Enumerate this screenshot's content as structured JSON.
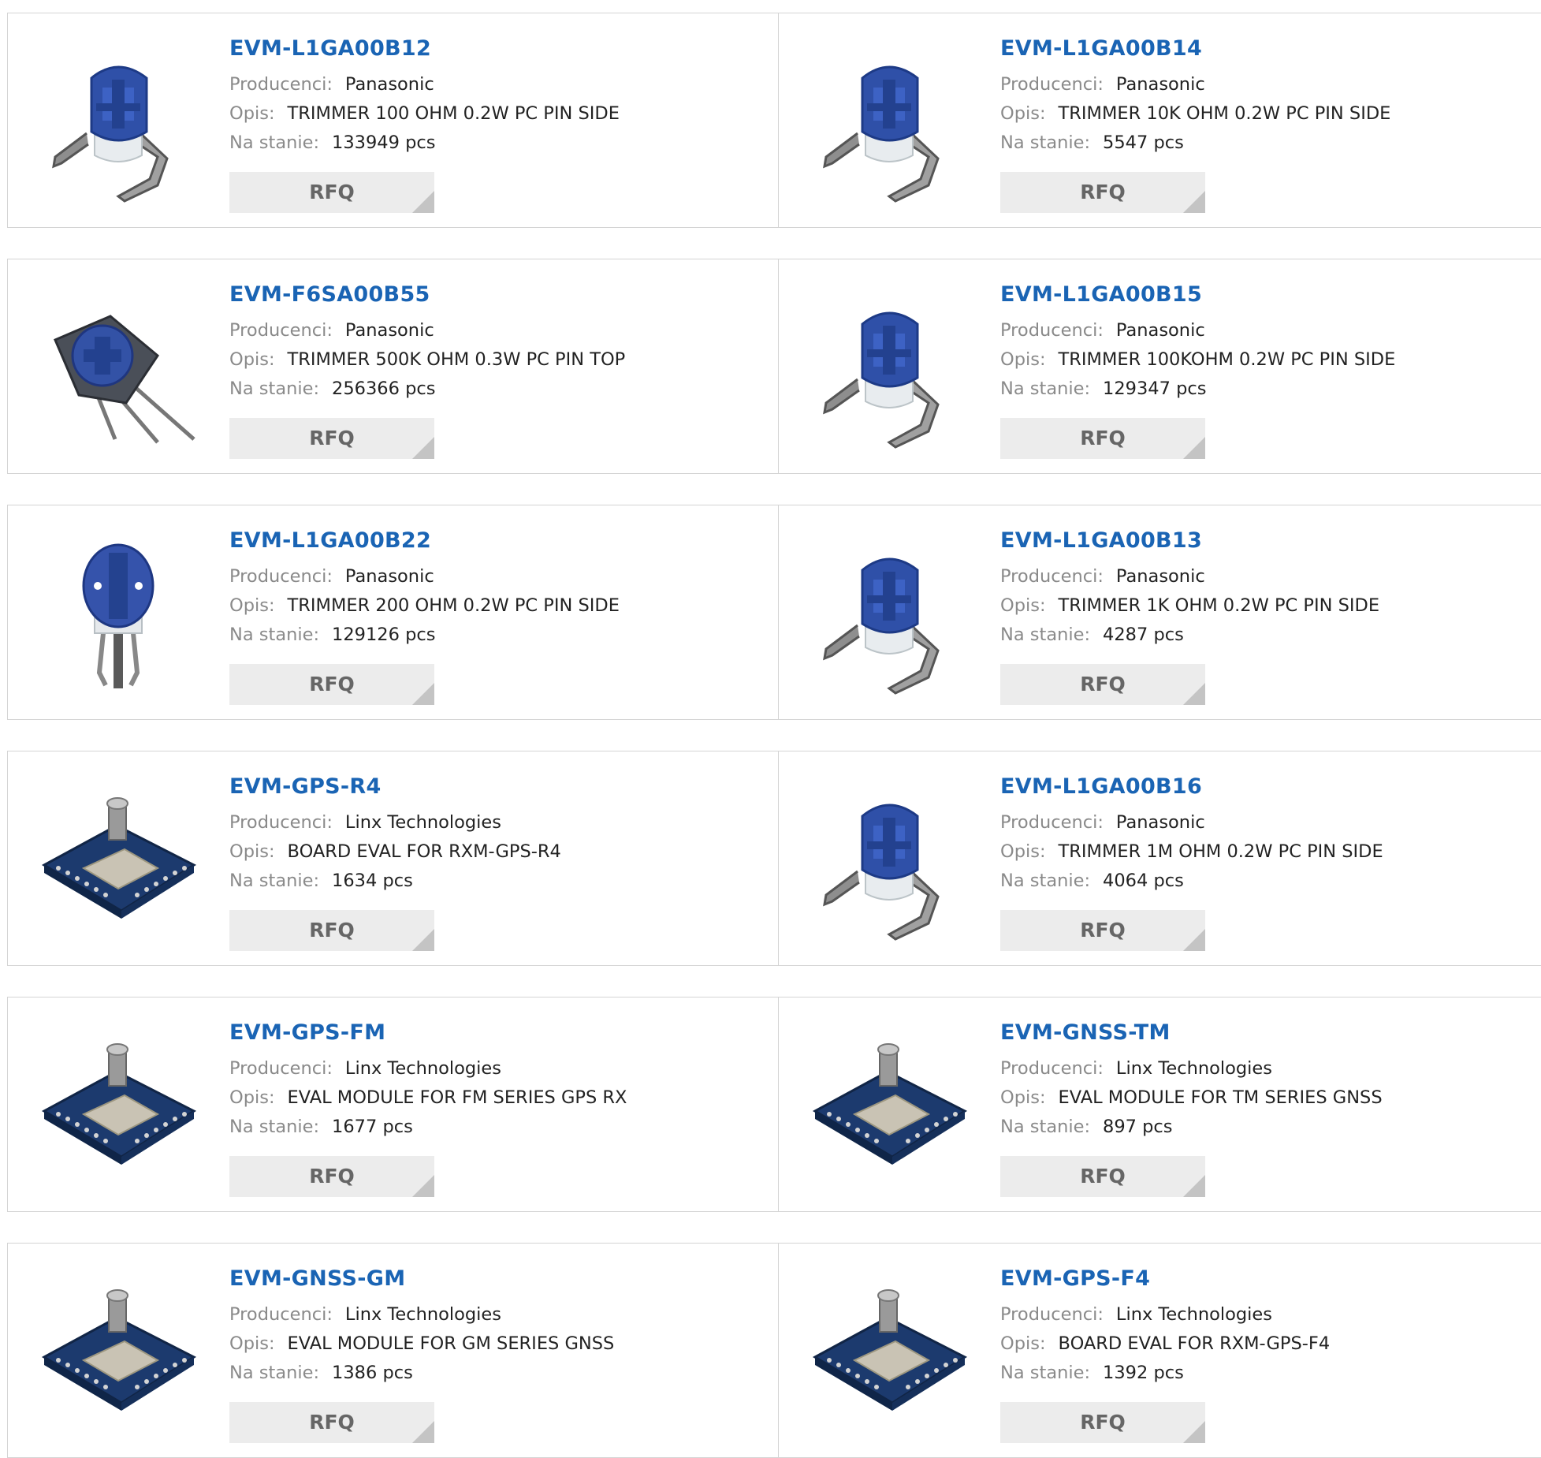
{
  "labels": {
    "manufacturer": "Producenci:",
    "description": "Opis:",
    "stock": "Na stanie:",
    "rfq": "RFQ"
  },
  "products": [
    {
      "part": "EVM-L1GA00B12",
      "manufacturer": "Panasonic",
      "description": "TRIMMER 100 OHM 0.2W PC PIN SIDE",
      "stock": "133949 pcs",
      "image": "trimmer-side"
    },
    {
      "part": "EVM-L1GA00B14",
      "manufacturer": "Panasonic",
      "description": "TRIMMER 10K OHM 0.2W PC PIN SIDE",
      "stock": "5547 pcs",
      "image": "trimmer-side"
    },
    {
      "part": "EVM-F6SA00B55",
      "manufacturer": "Panasonic",
      "description": "TRIMMER 500K OHM 0.3W PC PIN TOP",
      "stock": "256366 pcs",
      "image": "trimmer-top"
    },
    {
      "part": "EVM-L1GA00B15",
      "manufacturer": "Panasonic",
      "description": "TRIMMER 100KOHM 0.2W PC PIN SIDE",
      "stock": "129347 pcs",
      "image": "trimmer-side"
    },
    {
      "part": "EVM-L1GA00B22",
      "manufacturer": "Panasonic",
      "description": "TRIMMER 200 OHM 0.2W PC PIN SIDE",
      "stock": "129126 pcs",
      "image": "trimmer-front"
    },
    {
      "part": "EVM-L1GA00B13",
      "manufacturer": "Panasonic",
      "description": "TRIMMER 1K OHM 0.2W PC PIN SIDE",
      "stock": "4287 pcs",
      "image": "trimmer-side"
    },
    {
      "part": "EVM-GPS-R4",
      "manufacturer": "Linx Technologies",
      "description": "BOARD EVAL FOR RXM-GPS-R4",
      "stock": "1634 pcs",
      "image": "eval-board"
    },
    {
      "part": "EVM-L1GA00B16",
      "manufacturer": "Panasonic",
      "description": "TRIMMER 1M OHM 0.2W PC PIN SIDE",
      "stock": "4064 pcs",
      "image": "trimmer-side"
    },
    {
      "part": "EVM-GPS-FM",
      "manufacturer": "Linx Technologies",
      "description": "EVAL MODULE FOR FM SERIES GPS RX",
      "stock": "1677 pcs",
      "image": "eval-board"
    },
    {
      "part": "EVM-GNSS-TM",
      "manufacturer": "Linx Technologies",
      "description": "EVAL MODULE FOR TM SERIES GNSS",
      "stock": "897 pcs",
      "image": "eval-board"
    },
    {
      "part": "EVM-GNSS-GM",
      "manufacturer": "Linx Technologies",
      "description": "EVAL MODULE FOR GM SERIES GNSS",
      "stock": "1386 pcs",
      "image": "eval-board"
    },
    {
      "part": "EVM-GPS-F4",
      "manufacturer": "Linx Technologies",
      "description": "BOARD EVAL FOR RXM-GPS-F4",
      "stock": "1392 pcs",
      "image": "eval-board"
    }
  ]
}
